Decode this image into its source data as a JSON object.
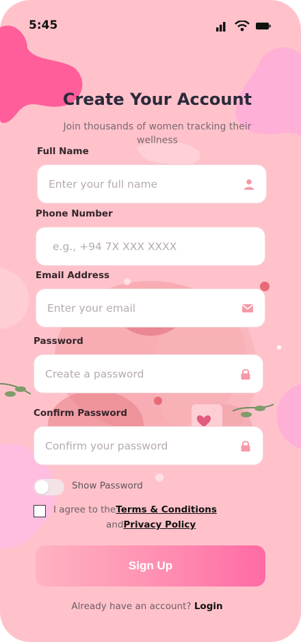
{
  "status": {
    "time": "5:45"
  },
  "header": {
    "title": "Create Your Account",
    "subtitle": "Join thousands of women tracking their wellness"
  },
  "form": {
    "full_name": {
      "label": "Full Name",
      "placeholder": "Enter your full name",
      "icon": "person-icon"
    },
    "phone": {
      "label": "Phone Number",
      "placeholder": "e.g., +94 7X XXX XXXX"
    },
    "email": {
      "label": "Email Address",
      "placeholder": "Enter your email",
      "icon": "mail-icon"
    },
    "password": {
      "label": "Password",
      "placeholder": "Create a password",
      "icon": "lock-icon"
    },
    "confirm_password": {
      "label": "Confirm Password",
      "placeholder": "Confirm your password",
      "icon": "lock-icon"
    },
    "show_password": {
      "label": "Show Password",
      "on": false
    },
    "terms": {
      "prefix": "I agree to the",
      "terms_link": "Terms & Conditions",
      "and": "and",
      "privacy_link": "Privacy Policy",
      "checked": false
    },
    "submit_label": "Sign Up"
  },
  "footer": {
    "prompt": "Already have an account?",
    "login_link": "Login"
  },
  "colors": {
    "background": "#ffc2cb",
    "accent": "#ff6aa5",
    "blob_dark": "#ff5e9a",
    "blob_light": "#ffb3d9",
    "icon_pink": "#f59aa8"
  }
}
